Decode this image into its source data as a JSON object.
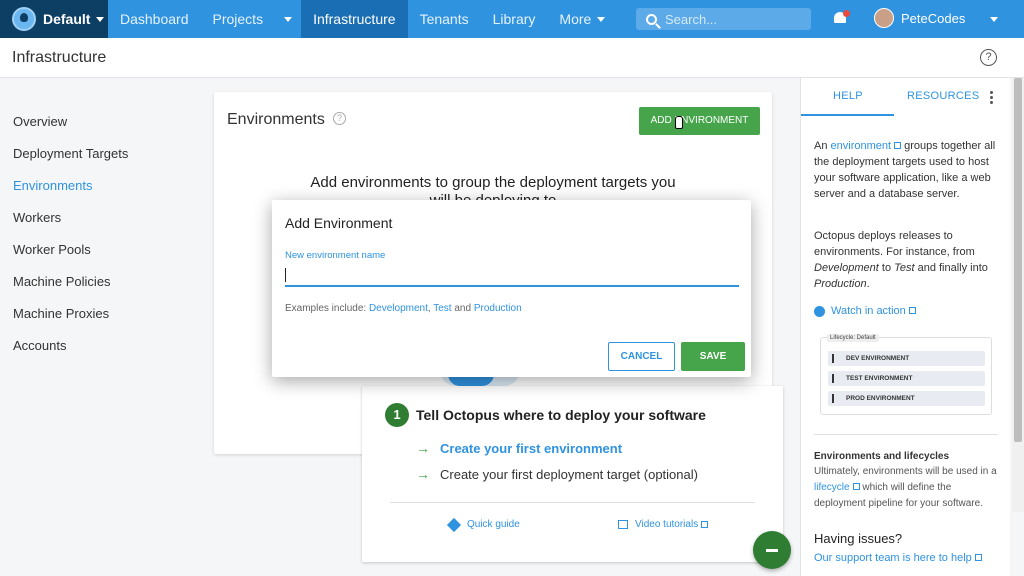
{
  "topnav": {
    "space": "Default",
    "items": [
      "Dashboard",
      "Projects",
      "Infrastructure",
      "Tenants",
      "Library",
      "More"
    ],
    "search_placeholder": "Search...",
    "user": "PeteCodes"
  },
  "page": {
    "title": "Infrastructure"
  },
  "sidebar": {
    "items": [
      "Overview",
      "Deployment Targets",
      "Environments",
      "Workers",
      "Worker Pools",
      "Machine Policies",
      "Machine Proxies",
      "Accounts"
    ]
  },
  "card": {
    "title": "Environments",
    "add_button": "ADD ENVIRONMENT",
    "headline_line1": "Add environments to group the deployment targets you",
    "headline_line2": "will be deploying to"
  },
  "onboarding": {
    "step": "1",
    "title": "Tell Octopus where to deploy your software",
    "link1": "Create your first environment",
    "link2": "Create your first deployment target (optional)",
    "quick_guide": "Quick guide",
    "video_tutorials": "Video tutorials"
  },
  "help": {
    "tab_help": "HELP",
    "tab_resources": "RESOURCES",
    "para1_pre": "An",
    "para1_link": "environment",
    "para1_post": "groups together all the deployment targets used to host your software application, like a web server and a database server.",
    "para2": "Octopus deploys releases to environments. For instance, from",
    "para2_dev": "Development",
    "para2_to": "to",
    "para2_test": "Test",
    "para2_and": "and finally into",
    "para2_prod": "Production",
    "watch": "Watch in action",
    "lifecycle_title": "Lifecycle: Default",
    "lifecycle_rows": [
      "DEV ENVIRONMENT",
      "TEST ENVIRONMENT",
      "PROD ENVIRONMENT"
    ],
    "section_title": "Environments and lifecycles",
    "section_pre": "Ultimately, environments will be used in a",
    "section_link": "lifecycle",
    "section_post": "which will define the deployment pipeline for your software.",
    "having_issues": "Having issues?",
    "support": "Our support team is here to help"
  },
  "modal": {
    "title": "Add Environment",
    "field_label": "New environment name",
    "field_value": "",
    "examples_pre": "Examples include:",
    "ex_dev": "Development",
    "ex_test": "Test",
    "ex_and": "and",
    "ex_prod": "Production",
    "cancel": "CANCEL",
    "save": "SAVE"
  },
  "colors": {
    "brand": "#2f93e0",
    "nav_dark": "#0d3e63",
    "success": "#46a44a"
  }
}
